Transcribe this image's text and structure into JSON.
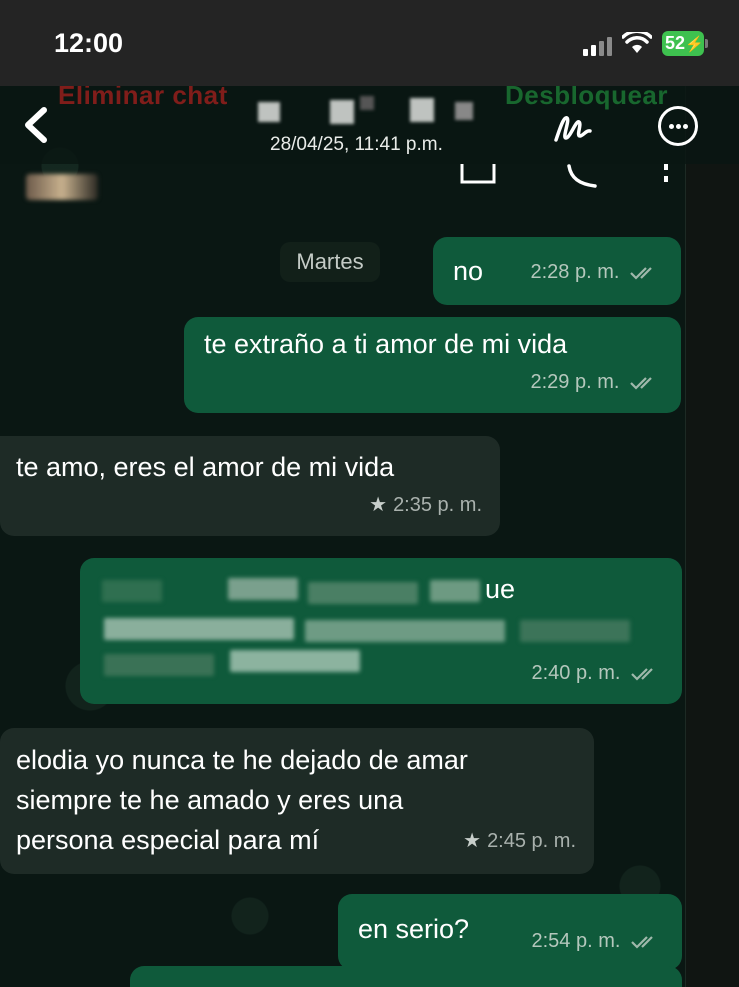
{
  "status_bar": {
    "time": "12:00",
    "battery": "52"
  },
  "viewer": {
    "date": "28/04/25, 11:41 p.m.",
    "faded_left": "Eliminar chat",
    "faded_right": "Desbloquear",
    "icons": [
      "back-arrow-icon",
      "markup-pen-icon",
      "more-options-icon"
    ]
  },
  "chat": {
    "day_label": "Martes",
    "messages": [
      {
        "dir": "out",
        "text": "no",
        "time": "2:28 p. m."
      },
      {
        "dir": "out",
        "text": "te extraño a ti amor de mi vida",
        "time": "2:29 p. m."
      },
      {
        "dir": "in",
        "text": "te amo, eres el amor de mi vida",
        "time": "2:35 p. m.",
        "starred": true
      },
      {
        "dir": "out",
        "text": "ue",
        "time": "2:40 p. m.",
        "redacted": true
      },
      {
        "dir": "in",
        "line1": "elodia yo nunca te he dejado de amar",
        "line2": "siempre te he amado y eres una",
        "line3": "persona especial para mí",
        "time": "2:45 p. m.",
        "starred": true
      },
      {
        "dir": "out",
        "text": "en serio?",
        "time": "2:54 p. m."
      }
    ]
  },
  "colors": {
    "outgoing": "#0f5a3b",
    "incoming": "#1e2b26",
    "read_check": "#8fb3a1"
  }
}
